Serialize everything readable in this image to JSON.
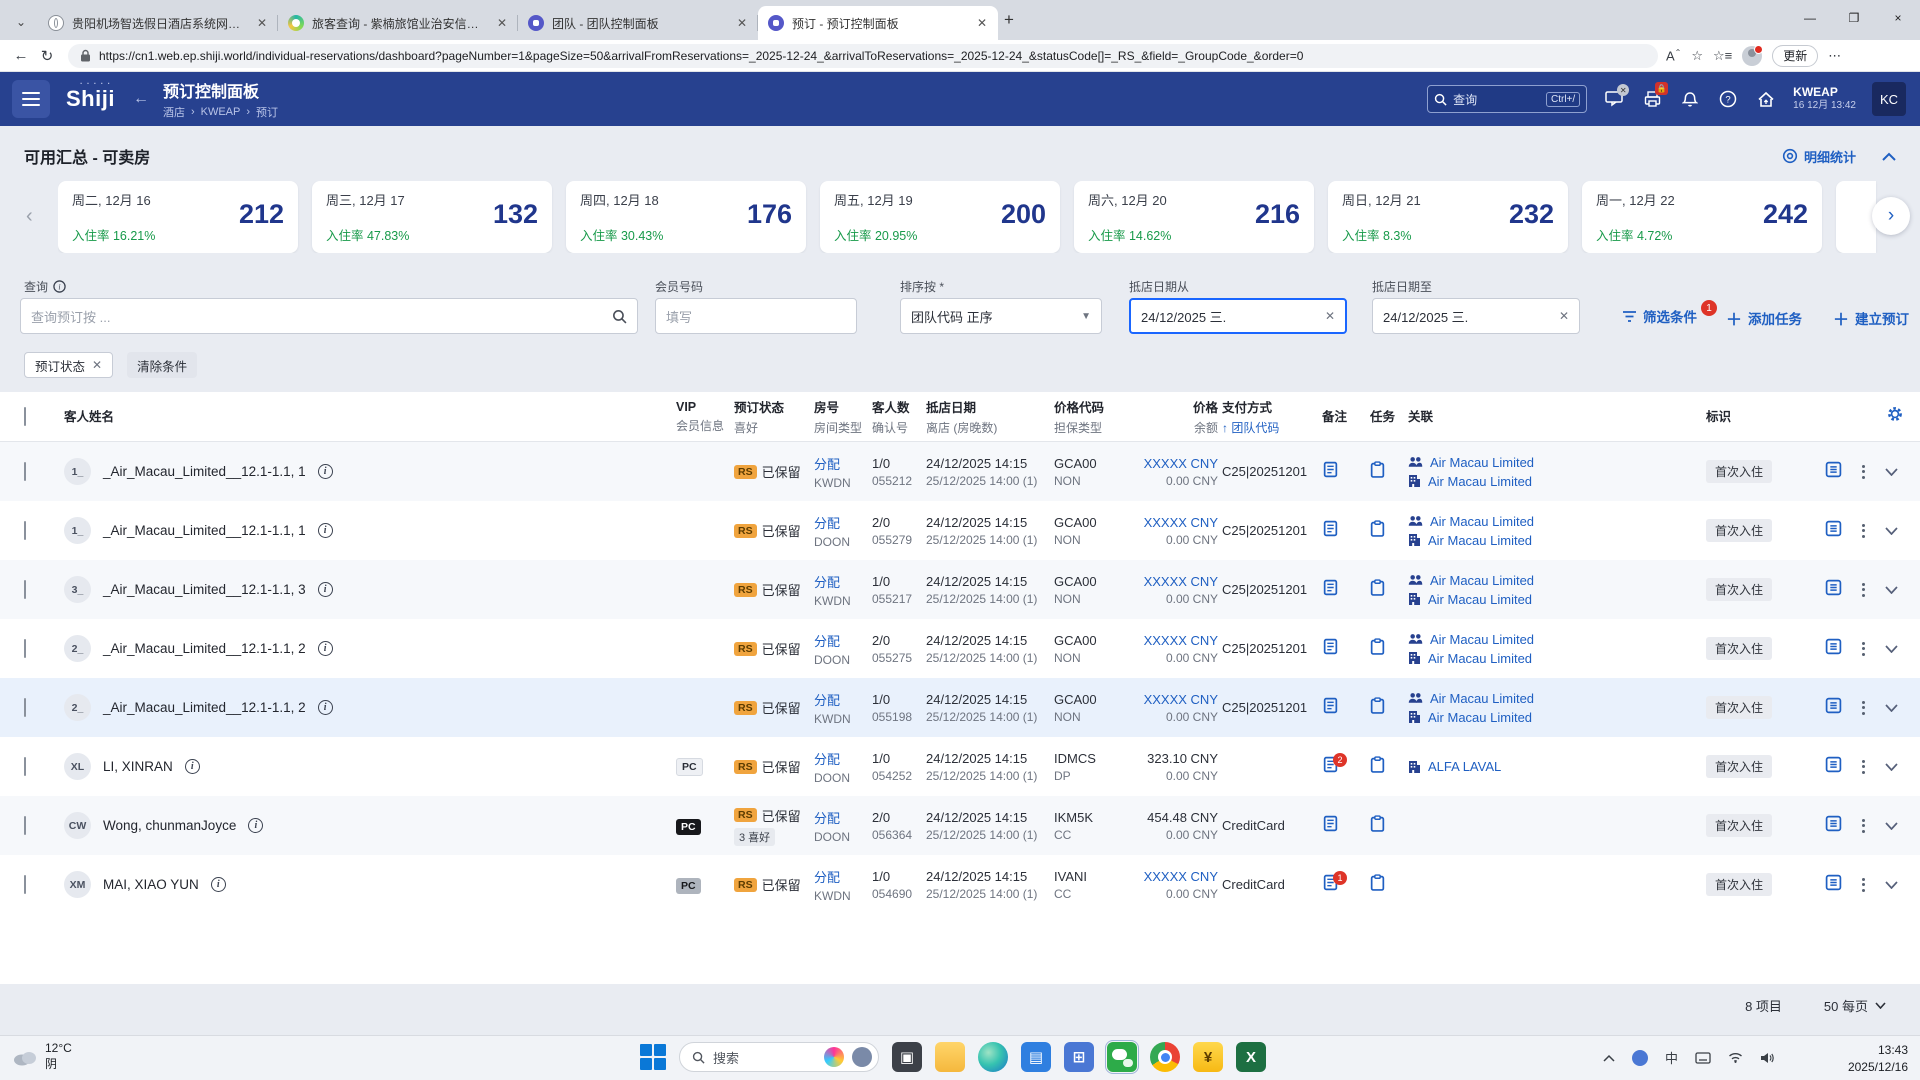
{
  "colors": {
    "appbar": "#27418f",
    "accent": "#1f5fc2",
    "green": "#189a4a",
    "rs_badge": "#f0a43e",
    "alert_red": "#de3428",
    "focus_blue": "#1a66ff"
  },
  "browser": {
    "tabs": [
      {
        "title": "贵阳机场智选假日酒店系统网址与",
        "icon": "globe",
        "active": false
      },
      {
        "title": "旅客查询 - 紫楠旅馆业治安信息管",
        "icon": "teal",
        "active": false
      },
      {
        "title": "团队 - 团队控制面板",
        "icon": "purple",
        "active": false
      },
      {
        "title": "预订 - 预订控制面板",
        "icon": "purple",
        "active": true
      }
    ],
    "url": "https://cn1.web.ep.shiji.world/individual-reservations/dashboard?pageNumber=1&pageSize=50&arrivalFromReservations=_2025-12-24_&arrivalToReservations=_2025-12-24_&statusCode[]=_RS_&field=_GroupCode_&order=0",
    "update_label": "更新"
  },
  "header": {
    "logo": "Shiji",
    "title": "预订控制面板",
    "breadcrumb": {
      "b1": "酒店",
      "b2": "KWEAP",
      "b3": "预订"
    },
    "search_placeholder": "查询",
    "search_shortcut": "Ctrl+/",
    "property": "KWEAP",
    "datetime": "16 12月 13:42",
    "avatar": "KC"
  },
  "summary": {
    "title": "可用汇总 - 可卖房",
    "stats_label": "明细统计",
    "cards": [
      {
        "date": "周二, 12月 16",
        "occ": "入住率 16.21%",
        "value": "212"
      },
      {
        "date": "周三, 12月 17",
        "occ": "入住率 47.83%",
        "value": "132"
      },
      {
        "date": "周四, 12月 18",
        "occ": "入住率 30.43%",
        "value": "176"
      },
      {
        "date": "周五, 12月 19",
        "occ": "入住率 20.95%",
        "value": "200"
      },
      {
        "date": "周六, 12月 20",
        "occ": "入住率 14.62%",
        "value": "216"
      },
      {
        "date": "周日, 12月 21",
        "occ": "入住率 8.3%",
        "value": "232"
      },
      {
        "date": "周一, 12月 22",
        "occ": "入住率 4.72%",
        "value": "242"
      }
    ]
  },
  "filters": {
    "query_label": "查询",
    "query_placeholder": "查询预订按 ...",
    "member_label": "会员号码",
    "member_placeholder": "填写",
    "sort_label": "排序按 *",
    "sort_value": "团队代码 正序",
    "from_label": "抵店日期从",
    "from_value": "24/12/2025 三.",
    "to_label": "抵店日期至",
    "to_value": "24/12/2025 三.",
    "filter_btn": "筛选条件",
    "filter_badge": "1",
    "add_task_btn": "添加任务",
    "create_btn": "建立预订"
  },
  "chips": {
    "status_chip": "预订状态",
    "clear_chip": "清除条件"
  },
  "table": {
    "headers": [
      {
        "l1": "客人姓名",
        "l2": ""
      },
      {
        "l1": "VIP",
        "l2": "会员信息"
      },
      {
        "l1": "预订状态",
        "l2": "喜好"
      },
      {
        "l1": "房号",
        "l2": "房间类型"
      },
      {
        "l1": "客人数",
        "l2": "确认号"
      },
      {
        "l1": "抵店日期",
        "l2": "离店 (房晚数)"
      },
      {
        "l1": "价格代码",
        "l2": "担保类型"
      },
      {
        "l1": "价格",
        "l2": "余额",
        "right": true
      },
      {
        "l1": "支付方式",
        "l2": "团队代码",
        "sorted": true
      },
      {
        "l1": "备注",
        "l2": ""
      },
      {
        "l1": "任务",
        "l2": ""
      },
      {
        "l1": "关联",
        "l2": ""
      },
      {
        "l1": "标识",
        "l2": ""
      }
    ],
    "rows": [
      {
        "avatar": "1_",
        "name": "_Air_Macau_Limited__12.1-1.1, 1",
        "vip": "",
        "vip_variant": "",
        "status_code": "RS",
        "status": "已保留",
        "prefs": "",
        "room": "分配",
        "room_type": "KWDN",
        "guests": "1/0",
        "conf": "055212",
        "arrival": "24/12/2025 14:15",
        "departure": "25/12/2025 14:00 (1)",
        "rate_code": "GCA00",
        "guarantee": "NON",
        "price": "XXXXX CNY",
        "price_masked": true,
        "balance": "0.00 CNY",
        "payment": "C25|20251201",
        "note_badge": "",
        "links": [
          {
            "type": "agent",
            "label": "Air Macau Limited"
          },
          {
            "type": "company",
            "label": "Air Macau Limited"
          }
        ],
        "tag": "首次入住",
        "highlighted": false
      },
      {
        "avatar": "1_",
        "name": "_Air_Macau_Limited__12.1-1.1, 1",
        "vip": "",
        "vip_variant": "",
        "status_code": "RS",
        "status": "已保留",
        "prefs": "",
        "room": "分配",
        "room_type": "DOON",
        "guests": "2/0",
        "conf": "055279",
        "arrival": "24/12/2025 14:15",
        "departure": "25/12/2025 14:00 (1)",
        "rate_code": "GCA00",
        "guarantee": "NON",
        "price": "XXXXX CNY",
        "price_masked": true,
        "balance": "0.00 CNY",
        "payment": "C25|20251201",
        "note_badge": "",
        "links": [
          {
            "type": "agent",
            "label": "Air Macau Limited"
          },
          {
            "type": "company",
            "label": "Air Macau Limited"
          }
        ],
        "tag": "首次入住",
        "highlighted": false
      },
      {
        "avatar": "3_",
        "name": "_Air_Macau_Limited__12.1-1.1, 3",
        "vip": "",
        "vip_variant": "",
        "status_code": "RS",
        "status": "已保留",
        "prefs": "",
        "room": "分配",
        "room_type": "KWDN",
        "guests": "1/0",
        "conf": "055217",
        "arrival": "24/12/2025 14:15",
        "departure": "25/12/2025 14:00 (1)",
        "rate_code": "GCA00",
        "guarantee": "NON",
        "price": "XXXXX CNY",
        "price_masked": true,
        "balance": "0.00 CNY",
        "payment": "C25|20251201",
        "note_badge": "",
        "links": [
          {
            "type": "agent",
            "label": "Air Macau Limited"
          },
          {
            "type": "company",
            "label": "Air Macau Limited"
          }
        ],
        "tag": "首次入住",
        "highlighted": false
      },
      {
        "avatar": "2_",
        "name": "_Air_Macau_Limited__12.1-1.1, 2",
        "vip": "",
        "vip_variant": "",
        "status_code": "RS",
        "status": "已保留",
        "prefs": "",
        "room": "分配",
        "room_type": "DOON",
        "guests": "2/0",
        "conf": "055275",
        "arrival": "24/12/2025 14:15",
        "departure": "25/12/2025 14:00 (1)",
        "rate_code": "GCA00",
        "guarantee": "NON",
        "price": "XXXXX CNY",
        "price_masked": true,
        "balance": "0.00 CNY",
        "payment": "C25|20251201",
        "note_badge": "",
        "links": [
          {
            "type": "agent",
            "label": "Air Macau Limited"
          },
          {
            "type": "company",
            "label": "Air Macau Limited"
          }
        ],
        "tag": "首次入住",
        "highlighted": false
      },
      {
        "avatar": "2_",
        "name": "_Air_Macau_Limited__12.1-1.1, 2",
        "vip": "",
        "vip_variant": "",
        "status_code": "RS",
        "status": "已保留",
        "prefs": "",
        "room": "分配",
        "room_type": "KWDN",
        "guests": "1/0",
        "conf": "055198",
        "arrival": "24/12/2025 14:15",
        "departure": "25/12/2025 14:00 (1)",
        "rate_code": "GCA00",
        "guarantee": "NON",
        "price": "XXXXX CNY",
        "price_masked": true,
        "balance": "0.00 CNY",
        "payment": "C25|20251201",
        "note_badge": "",
        "links": [
          {
            "type": "agent",
            "label": "Air Macau Limited"
          },
          {
            "type": "company",
            "label": "Air Macau Limited"
          }
        ],
        "tag": "首次入住",
        "highlighted": true
      },
      {
        "avatar": "XL",
        "name": "LI, XINRAN",
        "vip": "PC",
        "vip_variant": "light",
        "status_code": "RS",
        "status": "已保留",
        "prefs": "",
        "room": "分配",
        "room_type": "DOON",
        "guests": "1/0",
        "conf": "054252",
        "arrival": "24/12/2025 14:15",
        "departure": "25/12/2025 14:00 (1)",
        "rate_code": "IDMCS",
        "guarantee": "DP",
        "price": "323.10 CNY",
        "price_masked": false,
        "balance": "0.00 CNY",
        "payment": "",
        "note_badge": "2",
        "links": [
          {
            "type": "company",
            "label": "ALFA LAVAL"
          }
        ],
        "tag": "首次入住",
        "highlighted": false
      },
      {
        "avatar": "CW",
        "name": "Wong, chunmanJoyce",
        "vip": "PC",
        "vip_variant": "black",
        "status_code": "RS",
        "status": "已保留",
        "prefs": "3 喜好",
        "room": "分配",
        "room_type": "DOON",
        "guests": "2/0",
        "conf": "056364",
        "arrival": "24/12/2025 14:15",
        "departure": "25/12/2025 14:00 (1)",
        "rate_code": "IKM5K",
        "guarantee": "CC",
        "price": "454.48 CNY",
        "price_masked": false,
        "balance": "0.00 CNY",
        "payment": "CreditCard",
        "note_badge": "",
        "links": [],
        "tag": "首次入住",
        "highlighted": false
      },
      {
        "avatar": "XM",
        "name": "MAI, XIAO YUN",
        "vip": "PC",
        "vip_variant": "gray",
        "status_code": "RS",
        "status": "已保留",
        "prefs": "",
        "room": "分配",
        "room_type": "KWDN",
        "guests": "1/0",
        "conf": "054690",
        "arrival": "24/12/2025 14:15",
        "departure": "25/12/2025 14:00 (1)",
        "rate_code": "IVANI",
        "guarantee": "CC",
        "price": "XXXXX CNY",
        "price_masked": true,
        "balance": "0.00 CNY",
        "payment": "CreditCard",
        "note_badge": "1",
        "links": [],
        "tag": "首次入住",
        "highlighted": false
      }
    ]
  },
  "footer": {
    "count": "8 项目",
    "per_page": "50 每页"
  },
  "taskbar": {
    "weather_temp": "12°C",
    "weather_cond": "阴",
    "search_placeholder": "搜索",
    "ime": "中",
    "time": "13:43",
    "date": "2025/12/16"
  }
}
